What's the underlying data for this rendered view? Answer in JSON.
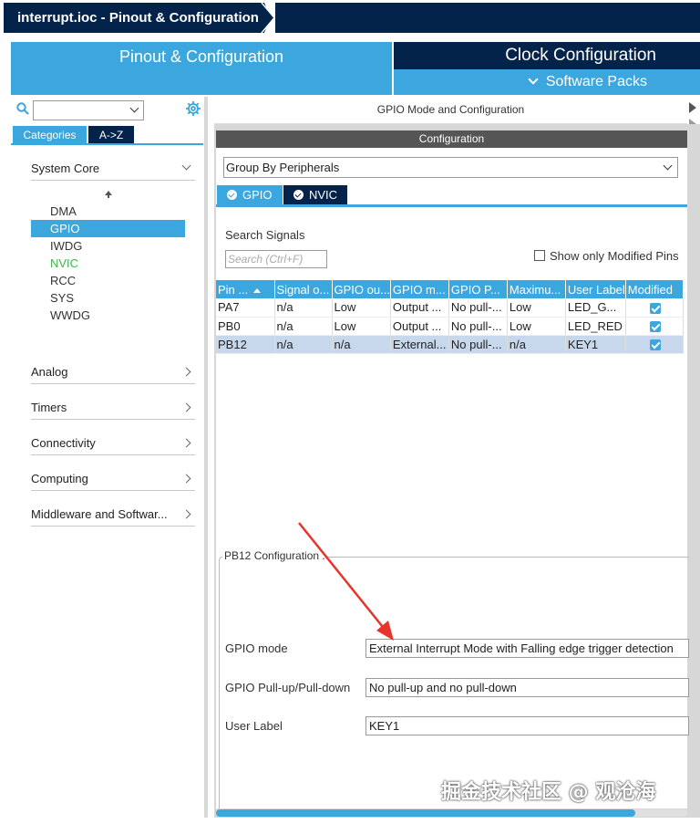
{
  "window": {
    "breadcrumb": "interrupt.ioc - Pinout & Configuration"
  },
  "main_tabs": {
    "pinout": "Pinout & Configuration",
    "clock": "Clock Configuration",
    "software_packs": "Software Packs"
  },
  "left_panel": {
    "search_placeholder": "",
    "tab_categories": "Categories",
    "tab_az": "A->Z",
    "categories": [
      {
        "label": "System Core",
        "expanded": true
      },
      {
        "label": "Analog"
      },
      {
        "label": "Timers"
      },
      {
        "label": "Connectivity"
      },
      {
        "label": "Computing"
      },
      {
        "label": "Middleware and Softwar..."
      }
    ],
    "system_core_items": [
      {
        "label": "DMA",
        "state": "normal"
      },
      {
        "label": "GPIO",
        "state": "selected"
      },
      {
        "label": "IWDG",
        "state": "normal"
      },
      {
        "label": "NVIC",
        "state": "configured"
      },
      {
        "label": "RCC",
        "state": "normal"
      },
      {
        "label": "SYS",
        "state": "normal"
      },
      {
        "label": "WWDG",
        "state": "normal"
      }
    ]
  },
  "right_panel": {
    "title": "GPIO Mode and Configuration",
    "config_header": "Configuration",
    "group_by": "Group By Peripherals",
    "subtabs": [
      {
        "label": "GPIO"
      },
      {
        "label": "NVIC"
      }
    ],
    "search_signals_label": "Search Signals",
    "search_placeholder": "Search (Ctrl+F)",
    "show_modified_label": "Show only Modified Pins",
    "table": {
      "headers": [
        "Pin ...",
        "Signal o...",
        "GPIO ou...",
        "GPIO m...",
        "GPIO P...",
        "Maximu...",
        "User Label",
        "Modified"
      ],
      "rows": [
        {
          "cells": [
            "PA7",
            "n/a",
            "Low",
            "Output ...",
            "No pull-...",
            "Low",
            "LED_G..."
          ],
          "modified": true,
          "selected": false
        },
        {
          "cells": [
            "PB0",
            "n/a",
            "Low",
            "Output ...",
            "No pull-...",
            "Low",
            "LED_RED"
          ],
          "modified": true,
          "selected": false
        },
        {
          "cells": [
            "PB12",
            "n/a",
            "n/a",
            "External...",
            "No pull-...",
            "n/a",
            "KEY1"
          ],
          "modified": true,
          "selected": true
        }
      ]
    },
    "pin_config": {
      "title": "PB12 Configuration :",
      "fields": [
        {
          "label": "GPIO mode",
          "value": "External Interrupt Mode with Falling edge trigger detection"
        },
        {
          "label": "GPIO Pull-up/Pull-down",
          "value": "No pull-up and no pull-down"
        },
        {
          "label": "User Label",
          "value": "KEY1"
        }
      ]
    }
  },
  "watermark": "掘金技术社区 @ 观沧海",
  "colors": {
    "accent": "#3ca6de",
    "dark": "#03234b",
    "configured": "#3bb54a",
    "annotation": "#e8332a"
  }
}
